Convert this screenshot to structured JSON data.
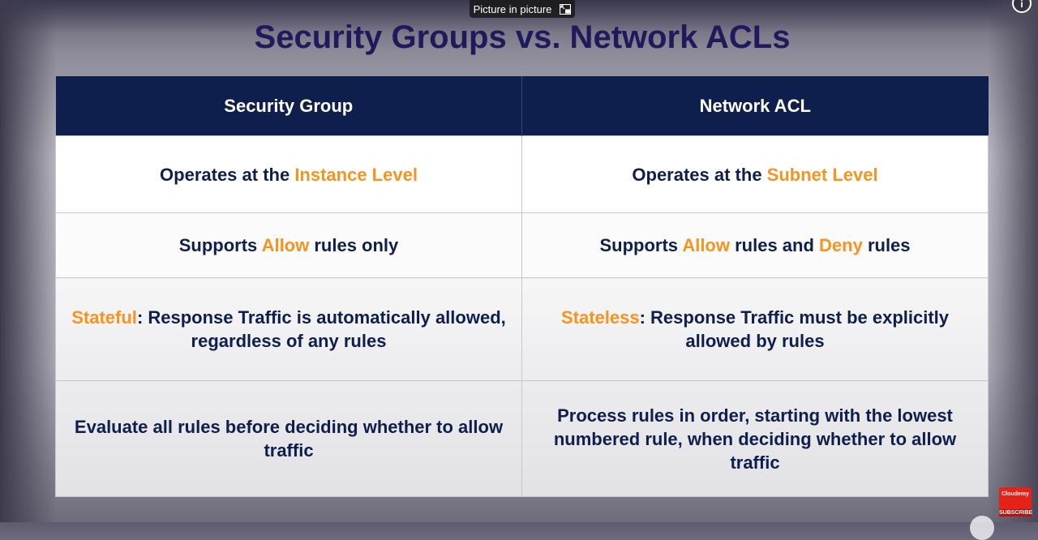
{
  "overlay": {
    "pip_label": "Picture in picture",
    "pip_icon": "pip-icon",
    "info_icon": "info-icon"
  },
  "slide": {
    "title": "Security Groups vs. Network ACLs",
    "accent_color": "#f7931e",
    "header_color": "#0f1f4d"
  },
  "table": {
    "headers": [
      "Security Group",
      "Network ACL"
    ],
    "rows": [
      {
        "sg": {
          "pre": "Operates at the ",
          "hl": "Instance Level"
        },
        "nacl": {
          "pre": "Operates at the ",
          "hl": "Subnet Level"
        }
      },
      {
        "sg": {
          "pre": "Supports ",
          "hl": "Allow",
          "post": " rules only"
        },
        "nacl": {
          "pre": "Supports ",
          "hl": "Allow",
          "mid": " rules and ",
          "hl2": "Deny",
          "post": " rules"
        }
      },
      {
        "sg": {
          "hl": "Stateful",
          "post": ": Response Traffic is automatically allowed, regardless of any rules"
        },
        "nacl": {
          "hl": "Stateless",
          "post": ": Response Traffic must be explicitly allowed by rules"
        }
      },
      {
        "sg": {
          "text": "Evaluate all rules before deciding whether to allow traffic"
        },
        "nacl": {
          "text": "Process rules in order, starting with the lowest numbered rule, when deciding whether to allow traffic"
        }
      }
    ]
  },
  "badge": {
    "brand": "Cloudemy",
    "label": "SUBSCRIBE"
  }
}
